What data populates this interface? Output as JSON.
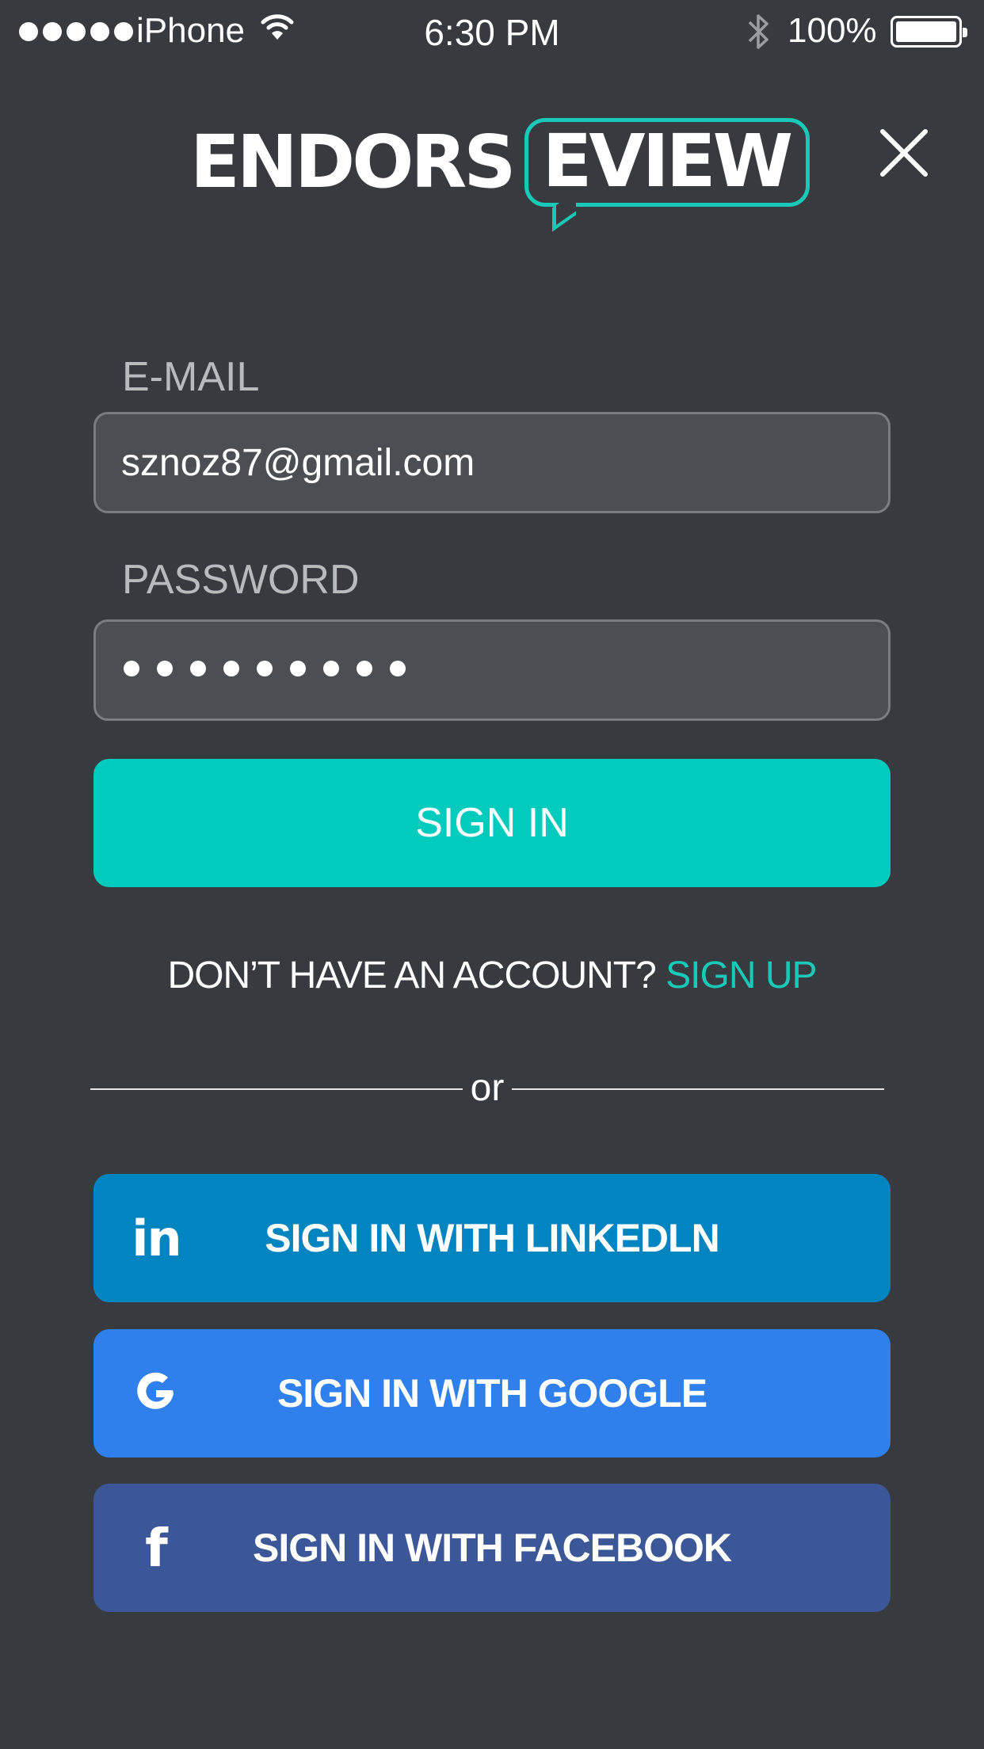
{
  "status_bar": {
    "carrier": "iPhone",
    "time": "6:30 PM",
    "battery_percent": "100%",
    "signal_icon": "signal-dots-icon",
    "wifi_icon": "wifi-icon",
    "bluetooth_icon": "bluetooth-icon",
    "battery_icon": "battery-full-icon"
  },
  "header": {
    "logo_text_1": "ENDORS",
    "logo_text_2": "EVIEW",
    "close_icon": "close-icon"
  },
  "form": {
    "email_label": "E-MAIL",
    "email_value": "sznoz87@gmail.com",
    "password_label": "PASSWORD",
    "password_masked_length": 9,
    "sign_in_label": "SIGN IN",
    "no_account_text": "DON’T HAVE AN ACCOUNT?",
    "sign_up_label": "SIGN UP",
    "divider_text": "or"
  },
  "social": {
    "linkedin_label": "SIGN IN WITH LINKEDLN",
    "linkedin_icon": "linkedin-icon",
    "google_label": "SIGN IN WITH GOOGLE",
    "google_icon": "google-icon",
    "facebook_label": "SIGN IN WITH FACEBOOK",
    "facebook_icon": "facebook-icon"
  },
  "colors": {
    "background": "#373b40",
    "accent": "#00cbbd",
    "linkedin": "#0185c1",
    "google": "#2f80ec",
    "facebook": "#3b5797"
  }
}
